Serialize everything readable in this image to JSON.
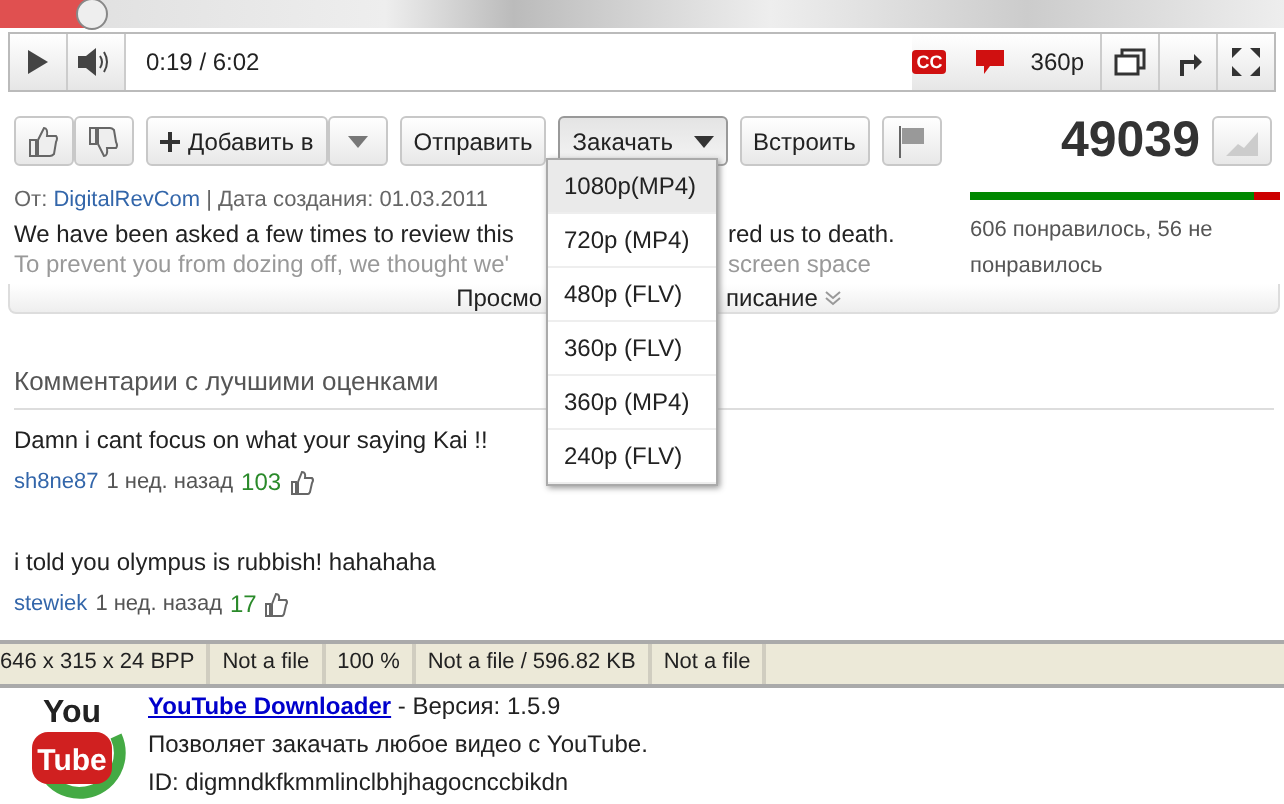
{
  "player": {
    "scrubber": {
      "level": 0.07
    },
    "time": "0:19 / 6:02",
    "captions": "CC",
    "quality": "360p"
  },
  "actions": {
    "add": "Добавить в",
    "share": "Отправить",
    "download": "Закачать",
    "embed": "Встроить",
    "views": "49039"
  },
  "meta": {
    "from": "От:",
    "author": "DigitalRevCom",
    "date": "| Дата создания: 01.03.2011"
  },
  "description": {
    "lines": [
      {
        "left": "We have been asked a few times to review this",
        "right": "red us to death."
      },
      {
        "left": "To prevent you from dozing off, we thought we'",
        "right": "screen space"
      }
    ],
    "more_left": "Просмо",
    "more_right": "писание"
  },
  "ratings": {
    "level": 0.915,
    "text": "606 понравилось, 56 не понравилось"
  },
  "download_menu": {
    "open": true,
    "items": [
      {
        "label": "1080p(MP4)",
        "selected": true
      },
      {
        "label": "720p (MP4)",
        "selected": false
      },
      {
        "label": "480p (FLV)",
        "selected": false
      },
      {
        "label": "360p (FLV)",
        "selected": false
      },
      {
        "label": "360p (MP4)",
        "selected": false
      },
      {
        "label": "240p (FLV)",
        "selected": false
      }
    ]
  },
  "comments": {
    "heading": "Комментарии с лучшими оценками",
    "items": [
      {
        "text": "Damn i cant focus on what your saying Kai !!",
        "author": "sh8ne87",
        "age": "1 нед. назад",
        "likes": "103"
      },
      {
        "text": "i told you olympus is rubbish! hahahaha",
        "author": "stewiek",
        "age": "1 нед. назад",
        "likes": "17"
      }
    ]
  },
  "status_bar": [
    "646 x 315 x 24 BPP",
    "Not a file",
    "100 %",
    "Not a file / 596.82 KB",
    "Not a file"
  ],
  "extension": {
    "logo_top": "You",
    "logo_bottom": "Tube",
    "name": "YouTube Downloader",
    "version": " - Версия: 1.5.9",
    "description": "Позволяет закачать любое видео с YouTube.",
    "id": "ID: digmndkfkmmlinclbhjhagocnccbikdn"
  }
}
